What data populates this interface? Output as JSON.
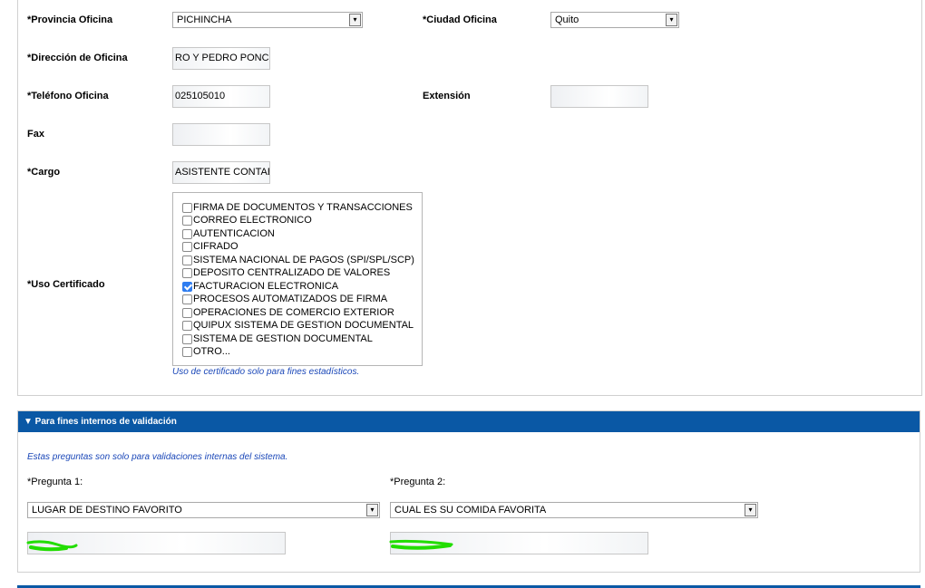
{
  "form": {
    "provincia": {
      "label": "*Provincia Oficina",
      "value": "PICHINCHA"
    },
    "ciudad": {
      "label": "*Ciudad Oficina",
      "value": "Quito"
    },
    "direccion": {
      "label": "*Dirección de Oficina",
      "value": "RO Y PEDRO PONCE C"
    },
    "telefono": {
      "label": "*Teléfono Oficina",
      "value": "025105010"
    },
    "extension": {
      "label": "Extensión",
      "value": ""
    },
    "fax": {
      "label": "Fax",
      "value": ""
    },
    "cargo": {
      "label": "*Cargo",
      "value": "ASISTENTE CONTABL"
    },
    "uso": {
      "label": "*Uso Certificado",
      "options": [
        {
          "label": "FIRMA DE DOCUMENTOS Y TRANSACCIONES",
          "checked": false
        },
        {
          "label": "CORREO ELECTRONICO",
          "checked": false
        },
        {
          "label": "AUTENTICACION",
          "checked": false
        },
        {
          "label": "CIFRADO",
          "checked": false
        },
        {
          "label": "SISTEMA NACIONAL DE PAGOS (SPI/SPL/SCP)",
          "checked": false
        },
        {
          "label": "DEPOSITO CENTRALIZADO DE VALORES",
          "checked": false
        },
        {
          "label": "FACTURACION ELECTRONICA",
          "checked": true
        },
        {
          "label": "PROCESOS AUTOMATIZADOS DE FIRMA",
          "checked": false
        },
        {
          "label": "OPERACIONES DE COMERCIO EXTERIOR",
          "checked": false
        },
        {
          "label": "QUIPUX SISTEMA DE GESTION DOCUMENTAL",
          "checked": false
        },
        {
          "label": "SISTEMA DE GESTION DOCUMENTAL",
          "checked": false
        },
        {
          "label": "OTRO...",
          "checked": false
        }
      ],
      "note": "Uso de certificado solo para fines estadísticos."
    }
  },
  "validation": {
    "header": "▼ Para fines internos de validación",
    "note": "Estas preguntas son solo para validaciones internas del sistema.",
    "q1": {
      "label": "*Pregunta 1:",
      "value": "LUGAR DE DESTINO FAVORITO",
      "answer": ""
    },
    "q2": {
      "label": "*Pregunta 2:",
      "value": "CUAL ES SU COMIDA FAVORITA",
      "answer": ""
    }
  },
  "colors": {
    "accent": "#0a58a5",
    "note": "#1a47b8",
    "checkbox": "#2f7df0",
    "redaction": "#22dd00"
  },
  "icons": {
    "dropdown": "▾"
  }
}
